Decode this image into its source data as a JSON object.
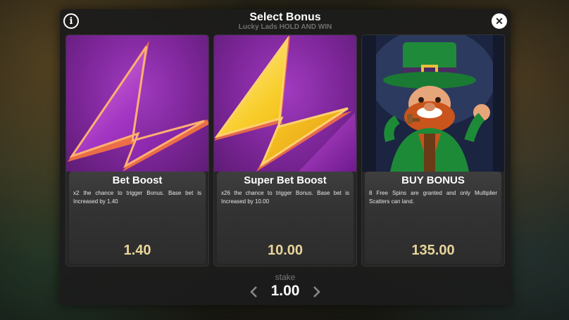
{
  "modal": {
    "title": "Select Bonus",
    "subtitle": "Lucky Lads HOLD AND WIN",
    "info_icon": "i",
    "close_icon": "✕"
  },
  "cards": [
    {
      "name": "Bet Boost",
      "description": "x2 the chance to trigger Bonus. Base bet is Increased by 1.40",
      "price": "1.40",
      "icon": "purple-lightning-bolt"
    },
    {
      "name": "Super Bet Boost",
      "description": "x26 the chance to trigger Bonus. Base bet is Increased by 10.00",
      "price": "10.00",
      "icon": "yellow-lightning-bolt"
    },
    {
      "name": "BUY BONUS",
      "description": "8 Free Spins are granted and only Multiplier Scatters can land.",
      "price": "135.00",
      "icon": "leprechaun"
    }
  ],
  "stake": {
    "label": "stake",
    "value": "1.00"
  },
  "colors": {
    "price": "#e8d59a",
    "purple": "#8a2aa8",
    "yellow": "#f5c32a"
  }
}
